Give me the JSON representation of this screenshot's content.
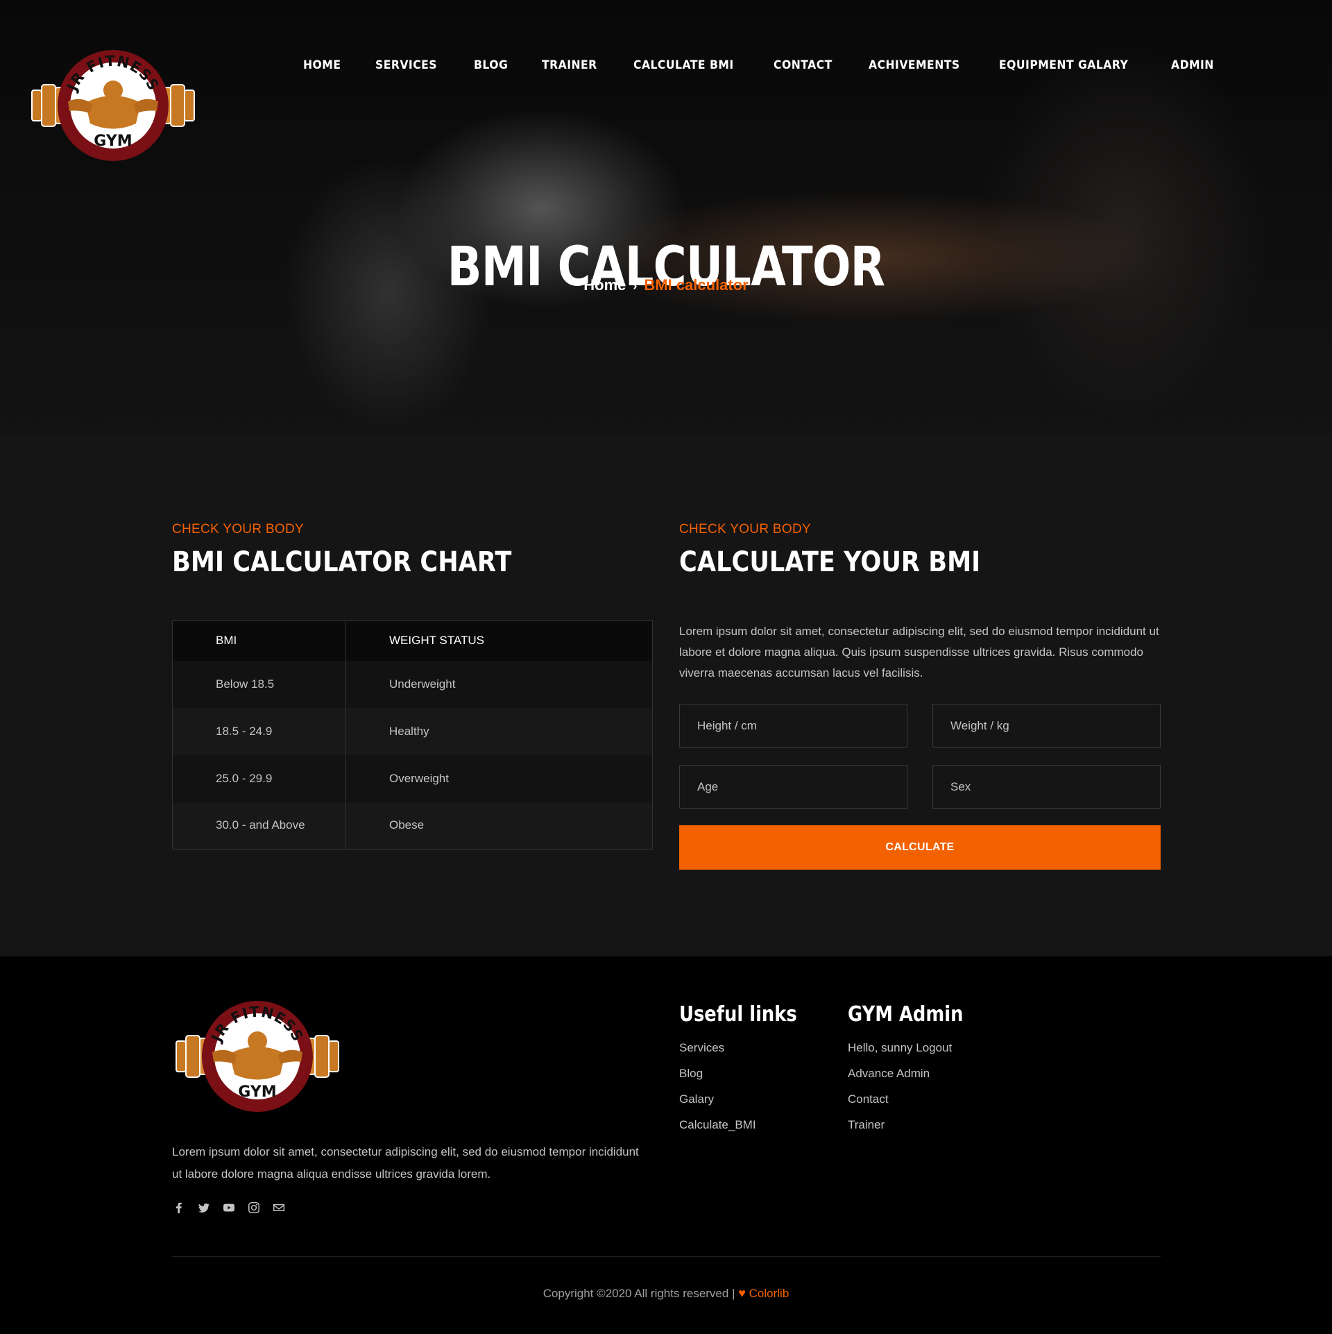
{
  "nav": {
    "items": [
      "HOME",
      "SERVICES",
      "BLOG",
      "TRAINER",
      "CALCULATE BMI",
      "CONTACT",
      "ACHIVEMENTS",
      "EQUIPMENT GALARY",
      "ADMIN"
    ]
  },
  "logo": {
    "top_text": "JR FITNESS",
    "bottom_text": "GYM"
  },
  "hero": {
    "title": "BMI CALCULATOR",
    "breadcrumb_home": "Home",
    "breadcrumb_separator": "›",
    "breadcrumb_current": "BMI calculator"
  },
  "chart_section": {
    "eyebrow": "CHECK YOUR BODY",
    "title": "BMI CALCULATOR CHART",
    "headers": [
      "BMI",
      "WEIGHT STATUS"
    ],
    "rows": [
      [
        "Below 18.5",
        "Underweight"
      ],
      [
        "18.5 - 24.9",
        "Healthy"
      ],
      [
        "25.0 - 29.9",
        "Overweight"
      ],
      [
        "30.0 - and Above",
        "Obese"
      ]
    ]
  },
  "calc_section": {
    "eyebrow": "CHECK YOUR BODY",
    "title": "CALCULATE YOUR BMI",
    "text": "Lorem ipsum dolor sit amet, consectetur adipiscing elit, sed do eiusmod tempor incididunt ut labore et dolore magna aliqua. Quis ipsum suspendisse ultrices gravida. Risus commodo viverra maecenas accumsan lacus vel facilisis.",
    "height_placeholder": "Height / cm",
    "weight_placeholder": "Weight / kg",
    "age_placeholder": "Age",
    "sex_placeholder": "Sex",
    "button_label": "CALCULATE"
  },
  "footer": {
    "text": "Lorem ipsum dolor sit amet, consectetur adipiscing elit, sed do eiusmod tempor incididunt ut labore dolore magna aliqua endisse ultrices gravida lorem.",
    "social_icons": [
      "facebook-icon",
      "twitter-icon",
      "youtube-icon",
      "instagram-icon",
      "mail-icon"
    ],
    "useful_links_title": "Useful links",
    "useful_links": [
      "Services",
      "Blog",
      "Galary",
      "Calculate_BMI"
    ],
    "admin_title": "GYM Admin",
    "admin_links": [
      "Hello, sunny Logout",
      "Advance Admin",
      "Contact",
      "Trainer"
    ],
    "copyright": "Copyright ©2020 All rights reserved |",
    "heart": "♥",
    "brand": "Colorlib"
  },
  "colors": {
    "accent": "#f36100",
    "section_bg": "#151515",
    "footer_bg": "#000000",
    "logo_ring": "#7a1015",
    "logo_gold": "#c77822"
  }
}
